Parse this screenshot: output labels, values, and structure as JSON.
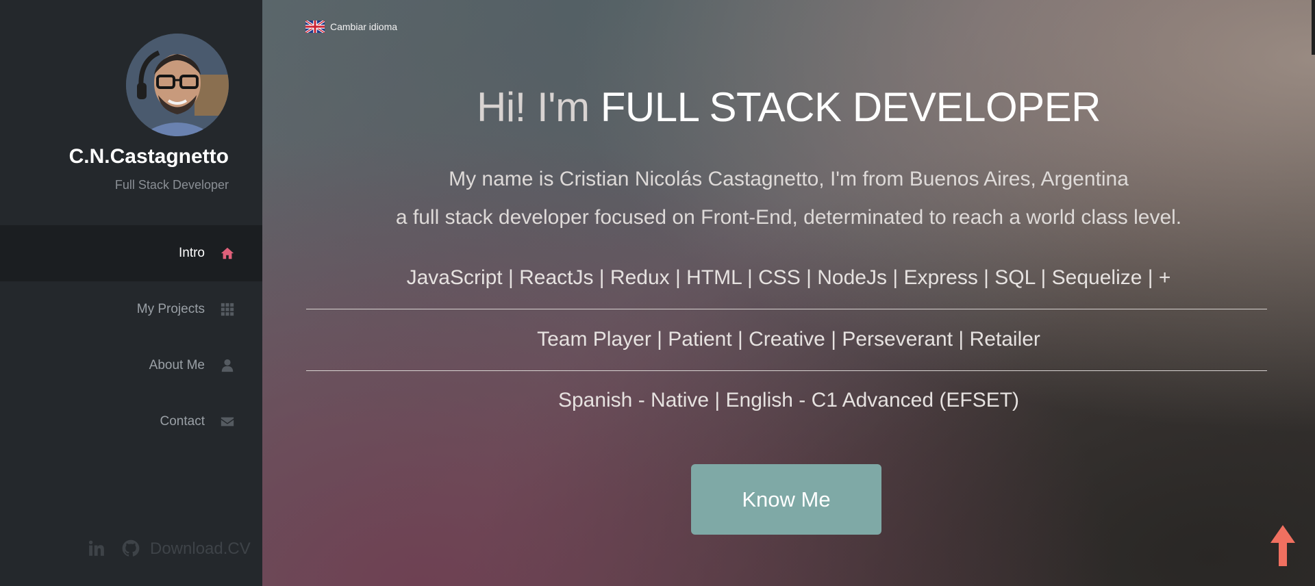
{
  "sidebar": {
    "brand_name": "C.N.Castagnetto",
    "brand_role": "Full Stack Developer",
    "nav": [
      {
        "label": "Intro",
        "icon": "home-icon",
        "active": true
      },
      {
        "label": "My Projects",
        "icon": "grid-icon",
        "active": false
      },
      {
        "label": "About Me",
        "icon": "user-icon",
        "active": false
      },
      {
        "label": "Contact",
        "icon": "envelope-icon",
        "active": false
      }
    ],
    "social": {
      "linkedin_icon": "linkedin-icon",
      "github_icon": "github-icon",
      "download_label": "Download.CV"
    }
  },
  "main": {
    "language_toggle": "Cambiar idioma",
    "hero_prefix": "Hi! I'm ",
    "hero_emphasis": "FULL STACK DEVELOPER",
    "intro_line_1": "My name is Cristian Nicolás Castagnetto, I'm from Buenos Aires, Argentina",
    "intro_line_2": "a full stack developer focused on Front-End, determinated to reach a world class level.",
    "tech_skills": "JavaScript | ReactJs | Redux | HTML | CSS | NodeJs | Express | SQL | Sequelize | +",
    "soft_skills": "Team Player | Patient | Creative | Perseverant | Retailer",
    "languages": "Spanish - Native | English - C1 Advanced (EFSET)",
    "cta_label": "Know Me"
  },
  "colors": {
    "sidebar_bg": "#24282c",
    "active_nav_bg": "#1b1e21",
    "accent_icon": "#e0607a",
    "cta_bg": "#7fa9a6",
    "scroll_top_arrow": "#f07060"
  }
}
